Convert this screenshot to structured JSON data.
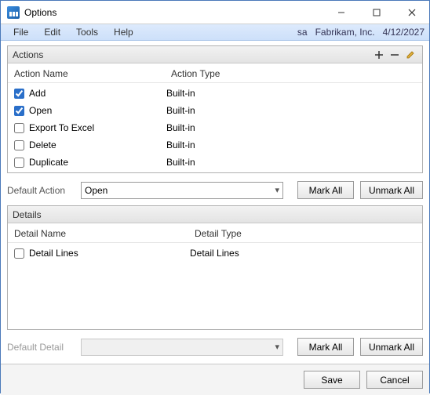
{
  "window": {
    "title": "Options"
  },
  "menu": {
    "file": "File",
    "edit": "Edit",
    "tools": "Tools",
    "help": "Help"
  },
  "status": {
    "user": "sa",
    "company": "Fabrikam, Inc.",
    "date": "4/12/2027"
  },
  "actions": {
    "panel_title": "Actions",
    "col_name": "Action Name",
    "col_type": "Action Type",
    "rows": [
      {
        "checked": true,
        "name": "Add",
        "type": "Built-in"
      },
      {
        "checked": true,
        "name": "Open",
        "type": "Built-in"
      },
      {
        "checked": false,
        "name": "Export To Excel",
        "type": "Built-in"
      },
      {
        "checked": false,
        "name": "Delete",
        "type": "Built-in"
      },
      {
        "checked": false,
        "name": "Duplicate",
        "type": "Built-in"
      }
    ],
    "default_label": "Default Action",
    "default_value": "Open",
    "mark_all": "Mark All",
    "unmark_all": "Unmark All"
  },
  "details": {
    "panel_title": "Details",
    "col_name": "Detail Name",
    "col_type": "Detail Type",
    "rows": [
      {
        "checked": false,
        "name": "Detail Lines",
        "type": "Detail Lines"
      }
    ],
    "default_label": "Default Detail",
    "default_value": "",
    "mark_all": "Mark All",
    "unmark_all": "Unmark All"
  },
  "footer": {
    "save": "Save",
    "cancel": "Cancel"
  }
}
